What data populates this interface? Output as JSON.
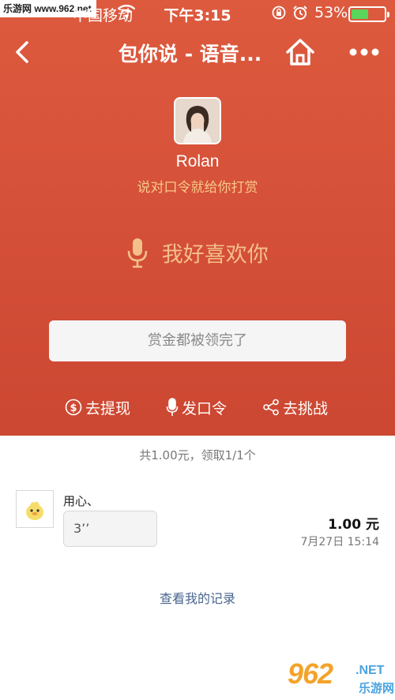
{
  "status_bar": {
    "site_watermark": "乐游网 www.962.net",
    "carrier": "中国移动",
    "time": "下午3:15",
    "battery_percent": "53%",
    "battery_level": 0.53
  },
  "nav": {
    "title": "包你说 - 语音..."
  },
  "profile": {
    "username": "Rolan",
    "tagline": "说对口令就给你打赏"
  },
  "voice_phrase": "我好喜欢你",
  "status_message": "赏金都被领完了",
  "actions": {
    "withdraw": "去提现",
    "post_password": "发口令",
    "challenge": "去挑战"
  },
  "summary": "共1.00元，领取1/1个",
  "records": [
    {
      "name": "用心、",
      "voice_duration": "3’’",
      "amount": "1.00 元",
      "time": "7月27日 15:14"
    }
  ],
  "history_link": "查看我的记录",
  "logo_watermark": {
    "number": "962",
    "domain": ".NET",
    "name": "乐游网"
  },
  "colors": {
    "header_red": "#d6523a",
    "accent_gold": "#f4c08a",
    "link_blue": "#4a6690"
  }
}
